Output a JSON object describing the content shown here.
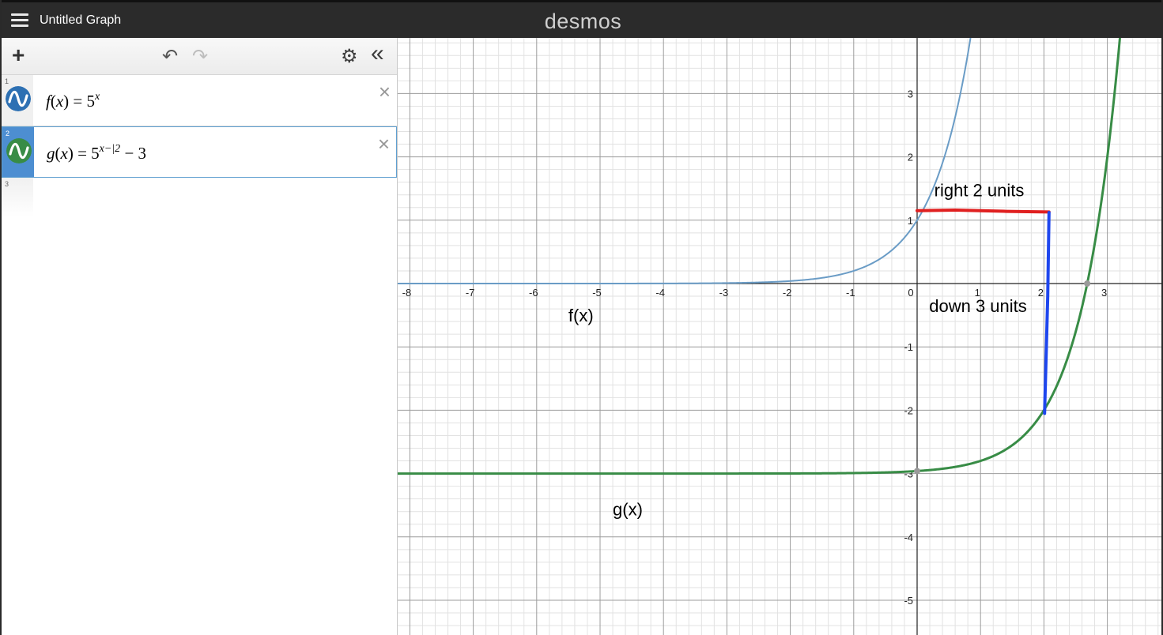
{
  "app": {
    "title": "Untitled Graph",
    "brand": "desmos"
  },
  "toolbar": {
    "add": "+",
    "undo": "↶",
    "redo": "↷",
    "settings": "⚙",
    "collapse": "«"
  },
  "expressions": [
    {
      "number": "1",
      "color": "#2d70b3",
      "name": "f",
      "arg": "x",
      "base": "5",
      "exponent": "x",
      "tail": ""
    },
    {
      "number": "2",
      "color": "#388c46",
      "name": "g",
      "arg": "x",
      "base": "5",
      "exponent": "x−|2",
      "tail": "− 3"
    },
    {
      "number": "3"
    }
  ],
  "icons": {
    "menu": "menu-icon",
    "delete": "×"
  },
  "graph": {
    "x_ticks": [
      "-8",
      "-7",
      "-6",
      "-5",
      "-4",
      "-3",
      "-2",
      "-1",
      "0",
      "1",
      "2",
      "3"
    ],
    "y_ticks": [
      "3",
      "2",
      "1",
      "-1",
      "-2",
      "-3",
      "-4",
      "-5"
    ],
    "annotations": {
      "right": "right 2 units",
      "down": "down 3 units",
      "f_label": "f(x)",
      "g_label": "g(x)"
    },
    "colors": {
      "f": "#6a9cc6",
      "g": "#388c46",
      "right_arrow": "#e02020",
      "down_arrow": "#1e46ee"
    }
  }
}
